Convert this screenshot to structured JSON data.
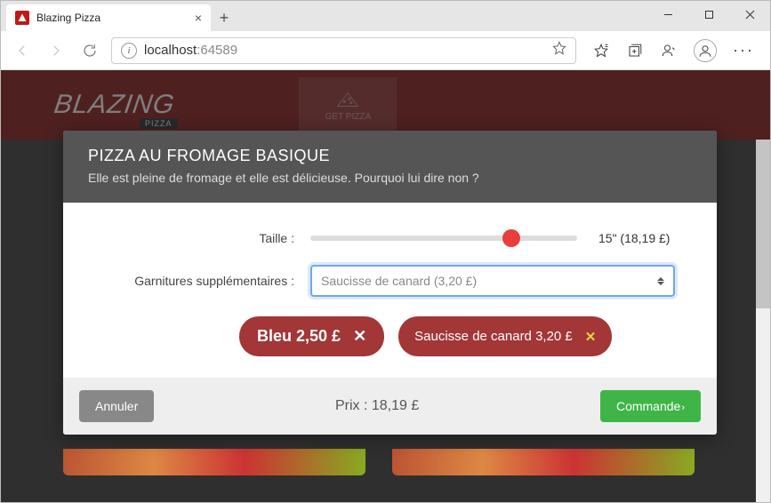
{
  "browser": {
    "tab_title": "Blazing Pizza",
    "new_tab_icon": "+",
    "url_host": "localhost",
    "url_port": ":64589"
  },
  "app": {
    "logo_text": "BLAZING",
    "logo_sub": "PIZZA",
    "nav_item": "GET PIZZA"
  },
  "modal": {
    "title": "PIZZA AU FROMAGE BASIQUE",
    "subtitle": "Elle est pleine de fromage et elle est délicieuse. Pourquoi lui dire non ?",
    "size_label": "Taille :",
    "size_value": "15\" (18,19 £)",
    "toppings_label": "Garnitures supplémentaires :",
    "toppings_select_text": "Saucisse de canard (3,20 £)",
    "chips": [
      {
        "label": "Bleu 2,50 £",
        "x_color": "white"
      },
      {
        "label": "Saucisse de canard 3,20 £",
        "x_color": "yellow"
      }
    ],
    "cancel": "Annuler",
    "price_label": "Prix : 18,19 £",
    "order": "Commande"
  }
}
